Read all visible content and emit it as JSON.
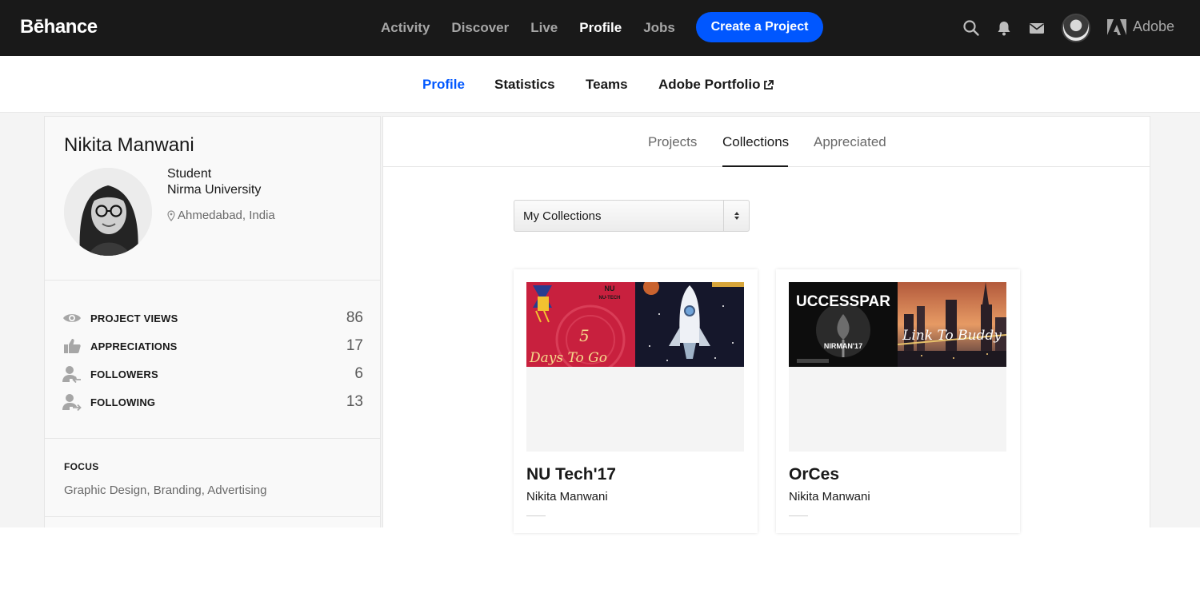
{
  "topbar": {
    "logo": "Bēhance",
    "nav": [
      "Activity",
      "Discover",
      "Live",
      "Profile",
      "Jobs"
    ],
    "active_nav": "Profile",
    "create_label": "Create a Project",
    "adobe_label": "Adobe"
  },
  "subnav": {
    "profile": "Profile",
    "statistics": "Statistics",
    "teams": "Teams",
    "portfolio": "Adobe Portfolio"
  },
  "profile": {
    "name": "Nikita Manwani",
    "occupation": "Student",
    "organization": "Nirma University",
    "location": "Ahmedabad, India"
  },
  "stats": [
    {
      "label": "PROJECT VIEWS",
      "value": "86",
      "icon": "eye-icon"
    },
    {
      "label": "APPRECIATIONS",
      "value": "17",
      "icon": "thumbs-up-icon"
    },
    {
      "label": "FOLLOWERS",
      "value": "6",
      "icon": "followers-icon"
    },
    {
      "label": "FOLLOWING",
      "value": "13",
      "icon": "following-icon"
    }
  ],
  "focus": {
    "title": "FOCUS",
    "value": "Graphic Design, Branding, Advertising"
  },
  "tabs": [
    "Projects",
    "Collections",
    "Appreciated"
  ],
  "active_tab": "Collections",
  "collection_select": {
    "selected": "My Collections"
  },
  "collections": [
    {
      "title": "NU Tech'17",
      "owner": "Nikita Manwani",
      "thumb_texts": [
        "NU",
        "NU-TECH",
        "5",
        "Days To Go"
      ]
    },
    {
      "title": "OrCes",
      "owner": "Nikita Manwani",
      "thumb_texts": [
        "UCCESSPAR",
        "NIRMAN'17",
        "Link To Buddy"
      ]
    }
  ],
  "colors": {
    "topbar_bg": "#191919",
    "accent": "#0057ff",
    "page_bg": "#f4f4f4"
  }
}
